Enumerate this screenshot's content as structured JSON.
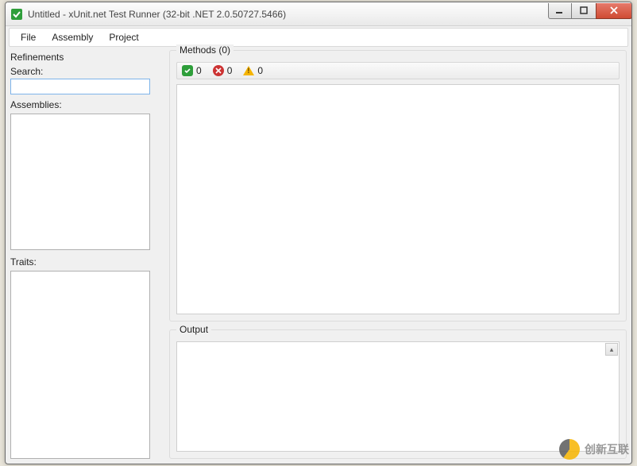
{
  "window": {
    "title": "Untitled - xUnit.net Test Runner (32-bit .NET 2.0.50727.5466)"
  },
  "menu": {
    "file": "File",
    "assembly": "Assembly",
    "project": "Project"
  },
  "refinements": {
    "heading": "Refinements",
    "search_label": "Search:",
    "search_value": "",
    "assemblies_label": "Assemblies:",
    "traits_label": "Traits:"
  },
  "methods": {
    "group_title": "Methods (0)",
    "pass_count": "0",
    "fail_count": "0",
    "warn_count": "0"
  },
  "output": {
    "group_title": "Output"
  },
  "watermark": {
    "text": "创新互联"
  }
}
